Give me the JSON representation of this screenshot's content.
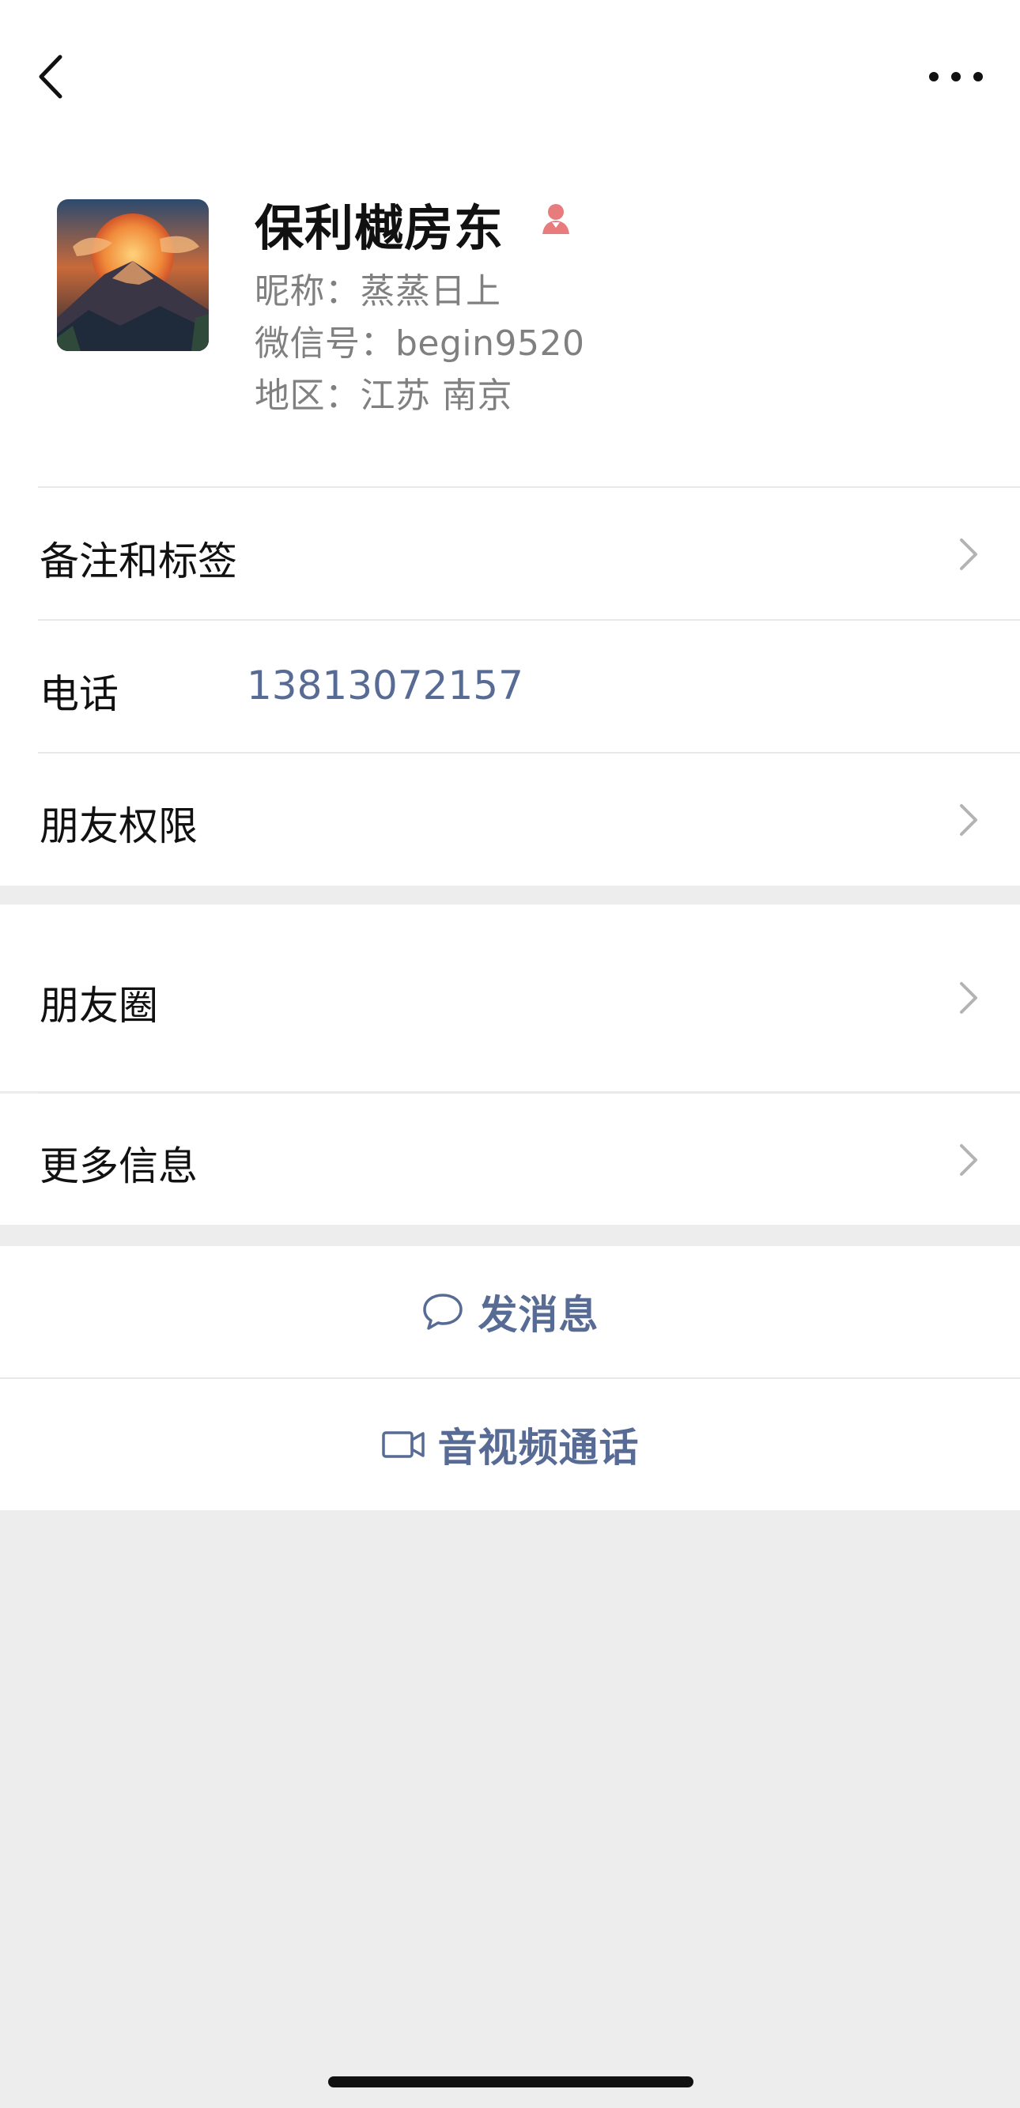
{
  "profile": {
    "name": "保利樾房东",
    "nickname": "昵称：蒸蒸日上",
    "wechat_id": "微信号：begin9520",
    "region": "地区：江苏 南京"
  },
  "rows": {
    "remark_tags": "备注和标签",
    "phone_label": "电话",
    "phone_value": "13813072157",
    "friend_permissions": "朋友权限",
    "moments": "朋友圈",
    "more_info": "更多信息"
  },
  "actions": {
    "message": "发消息",
    "call": "音视频通话"
  },
  "icons": {
    "back": "chevron-left-icon",
    "more": "more-dots-icon",
    "gender": "female-icon",
    "chevron": "chevron-right-icon",
    "message": "chat-bubble-icon",
    "video": "video-camera-icon"
  },
  "colors": {
    "link": "#576b95",
    "gender": "#e87c7c",
    "background": "#ededed"
  }
}
